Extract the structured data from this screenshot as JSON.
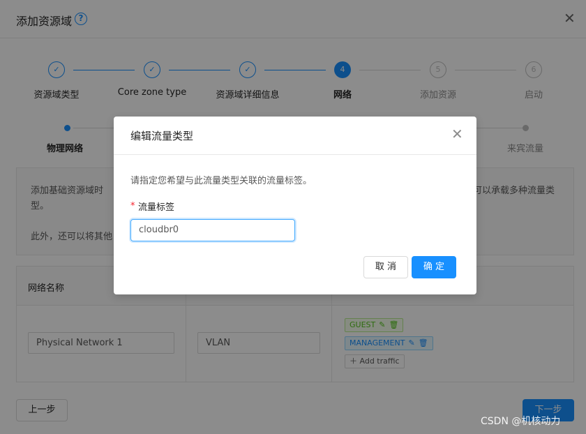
{
  "outer_dialog": {
    "title": "添加资源域",
    "help_icon": "question-circle-icon",
    "close_icon": "close-icon"
  },
  "steps": [
    {
      "index": "1",
      "label": "资源域类型",
      "state": "done"
    },
    {
      "index": "2",
      "label": "Core zone type",
      "state": "done"
    },
    {
      "index": "3",
      "label": "资源域详细信息",
      "state": "done"
    },
    {
      "index": "4",
      "label": "网络",
      "state": "active"
    },
    {
      "index": "5",
      "label": "添加资源",
      "state": "wait"
    },
    {
      "index": "6",
      "label": "启动",
      "state": "wait"
    }
  ],
  "substeps": {
    "first": "物理网络",
    "last": "来宾流量"
  },
  "info": {
    "line1_left": "添加基础资源域时",
    "line1_right": "可以承载多种流量类",
    "line2": "型。",
    "line3_left": "此外，还可以将其他"
  },
  "table": {
    "headers": [
      "网络名称"
    ],
    "row": {
      "network_name": "Physical Network 1",
      "isolation": "VLAN",
      "tags": [
        "GUEST",
        "MANAGEMENT"
      ],
      "add_traffic": "Add traffic"
    }
  },
  "footer": {
    "prev_button": "上一步",
    "next_button": "下一步"
  },
  "modal": {
    "title": "编辑流量类型",
    "description": "请指定您希望与此流量类型关联的流量标签。",
    "field_label": "流量标签",
    "field_required_mark": "*",
    "field_value": "cloudbr0",
    "cancel_button": "取 消",
    "ok_button": "确 定"
  },
  "watermark": "CSDN @机核动力",
  "colors": {
    "primary": "#1890ff",
    "guest_tag": "#52c41a"
  }
}
